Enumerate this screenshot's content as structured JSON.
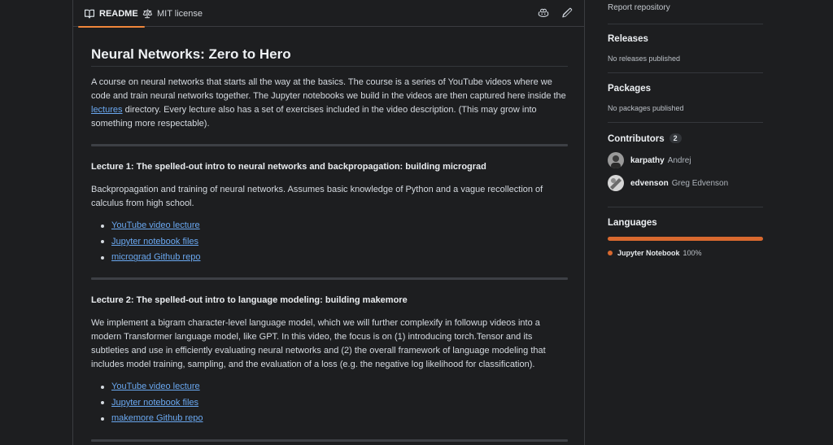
{
  "tabs": {
    "readme": "README",
    "license": "MIT license"
  },
  "readme": {
    "title": "Neural Networks: Zero to Hero",
    "intro": {
      "before": "A course on neural networks that starts all the way at the basics. The course is a series of YouTube videos where we code and train neural networks together. The Jupyter notebooks we build in the videos are then captured here inside the ",
      "link": "lectures",
      "after": " directory. Every lecture also has a set of exercises included in the video description. (This may grow into something more respectable)."
    },
    "lectures": [
      {
        "heading": "Lecture 1: The spelled-out intro to neural networks and backpropagation: building micrograd",
        "description": "Backpropagation and training of neural networks. Assumes basic knowledge of Python and a vague recollection of calculus from high school.",
        "links": [
          "YouTube video lecture",
          "Jupyter notebook files",
          "micrograd Github repo"
        ]
      },
      {
        "heading": "Lecture 2: The spelled-out intro to language modeling: building makemore",
        "description": "We implement a bigram character-level language model, which we will further complexify in followup videos into a modern Transformer language model, like GPT. In this video, the focus is on (1) introducing torch.Tensor and its subtleties and use in efficiently evaluating neural networks and (2) the overall framework of language modeling that includes model training, sampling, and the evaluation of a loss (e.g. the negative log likelihood for classification).",
        "links": [
          "YouTube video lecture",
          "Jupyter notebook files",
          "makemore Github repo"
        ]
      }
    ]
  },
  "sidebar": {
    "report_link": "Report repository",
    "releases": {
      "heading": "Releases",
      "empty": "No releases published"
    },
    "packages": {
      "heading": "Packages",
      "empty": "No packages published"
    },
    "contributors": {
      "heading": "Contributors",
      "count": "2",
      "people": [
        {
          "login": "karpathy",
          "name": "Andrej"
        },
        {
          "login": "edvenson",
          "name": "Greg Edvenson"
        }
      ]
    },
    "languages": {
      "heading": "Languages",
      "items": [
        {
          "name": "Jupyter Notebook",
          "percent": "100%",
          "share": 1.0,
          "color": "#d9692f"
        }
      ]
    }
  }
}
